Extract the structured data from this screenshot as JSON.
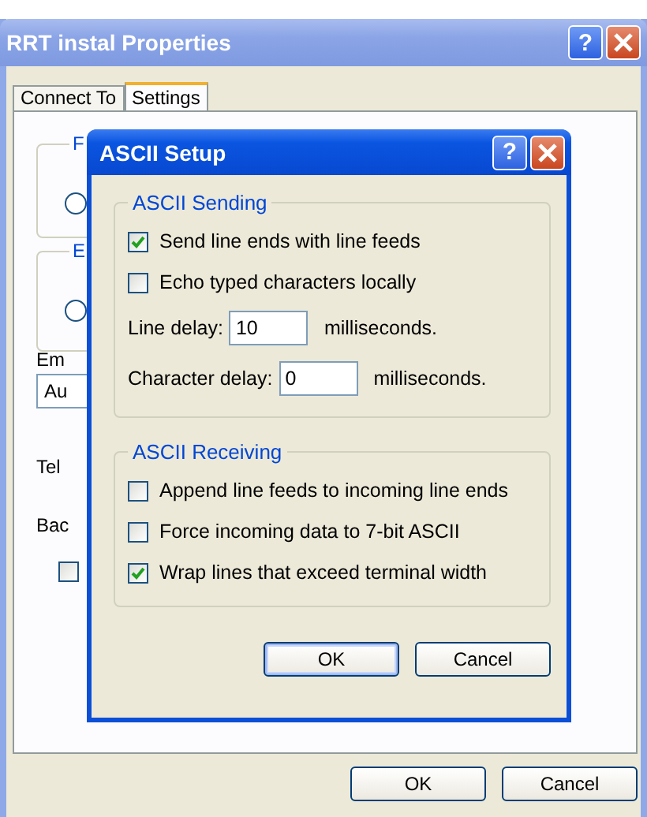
{
  "window": {
    "title": "RRT instal Properties",
    "help": "?",
    "active": false
  },
  "tabs": [
    {
      "label": "Connect To",
      "selected": false
    },
    {
      "label": "Settings",
      "selected": true
    }
  ],
  "settings_panel": {
    "groups": [
      {
        "label": "F",
        "radio_checked": false
      },
      {
        "label": "E",
        "radio_checked": false
      }
    ],
    "emulation_label": "Em",
    "emulation_value": "Au",
    "telnet_label": "Tel",
    "backspace_label": "Bac",
    "checkbox": {
      "checked": false
    }
  },
  "buttons": [
    "OK",
    "Cancel"
  ],
  "dialog": {
    "title": "ASCII Setup",
    "help": "?",
    "active": true,
    "sections": [
      {
        "title": "ASCII Sending",
        "items": [
          {
            "kind": "checkbox",
            "label": "Send line ends with line feeds",
            "checked": true
          },
          {
            "kind": "checkbox",
            "label": "Echo typed characters locally",
            "checked": false
          },
          {
            "kind": "field",
            "label": "Line delay:",
            "value": "10",
            "unit": "milliseconds."
          },
          {
            "kind": "field",
            "label": "Character delay:",
            "value": "0",
            "unit": "milliseconds."
          }
        ]
      },
      {
        "title": "ASCII Receiving",
        "items": [
          {
            "kind": "checkbox",
            "label": "Append line feeds to incoming line ends",
            "checked": false
          },
          {
            "kind": "checkbox",
            "label": "Force incoming data to 7-bit ASCII",
            "checked": false
          },
          {
            "kind": "checkbox",
            "label": "Wrap lines that exceed terminal width",
            "checked": true
          }
        ]
      }
    ],
    "buttons": [
      {
        "label": "OK",
        "default": true
      },
      {
        "label": "Cancel",
        "default": false
      }
    ]
  }
}
